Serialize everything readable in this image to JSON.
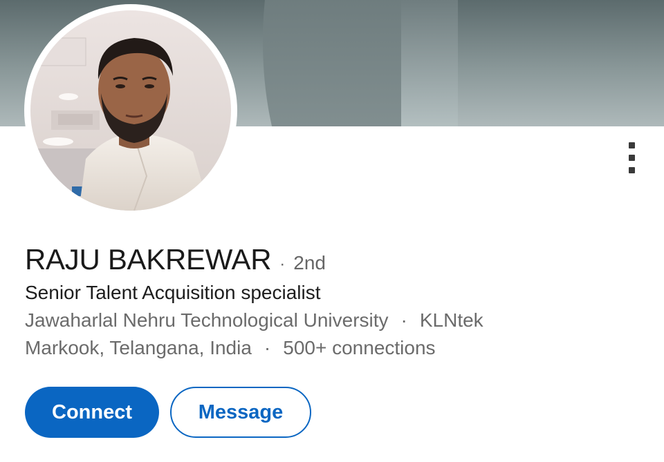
{
  "profile": {
    "name": "RAJU BAKREWAR",
    "separator": "·",
    "degree": "2nd",
    "headline": "Senior Talent Acquisition specialist",
    "education": "Jawaharlal Nehru Technological University",
    "company": "KLNtek",
    "location": "Markook, Telangana, India",
    "connections": "500+ connections"
  },
  "actions": {
    "connect_label": "Connect",
    "message_label": "Message"
  },
  "colors": {
    "accent": "#0a66c2",
    "name_text": "#1a1a1a",
    "secondary_text": "#6b6b6b"
  },
  "icons": {
    "more": "more-vertical-icon"
  }
}
